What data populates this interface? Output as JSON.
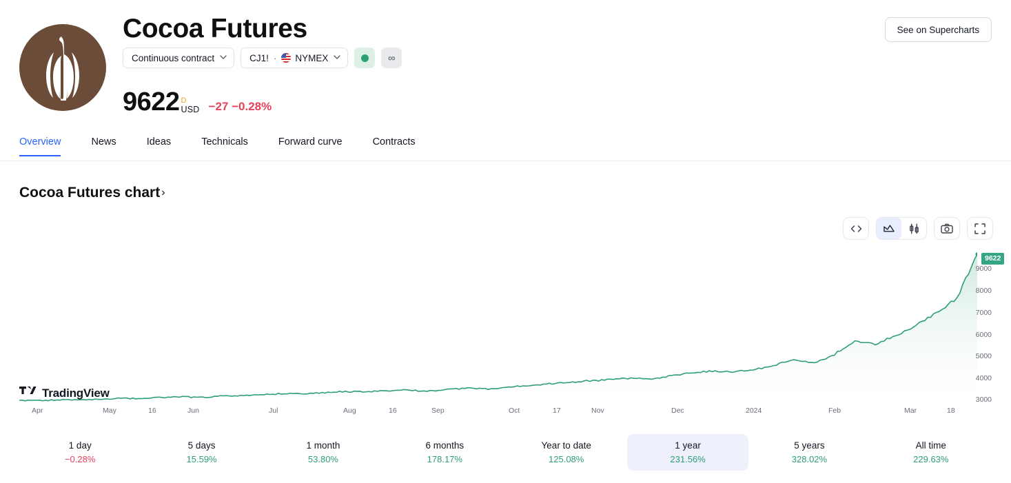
{
  "header": {
    "symbol_logo_name": "cocoa-pod-logo",
    "title": "Cocoa Futures",
    "contract_chip": "Continuous contract",
    "ticker": "CJ1!",
    "separator": "·",
    "exchange": "NYMEX",
    "flag_name": "us-flag-icon",
    "market_status_name": "market-open-dot",
    "continuous_badge": "∞",
    "supercharts_button": "See on Supercharts",
    "price": "9622",
    "price_interval": "D",
    "currency": "USD",
    "change_abs": "−27",
    "change_pct": "−0.28%",
    "change_direction": "down"
  },
  "tabs": [
    {
      "label": "Overview",
      "active": true
    },
    {
      "label": "News",
      "active": false
    },
    {
      "label": "Ideas",
      "active": false
    },
    {
      "label": "Technicals",
      "active": false
    },
    {
      "label": "Forward curve",
      "active": false
    },
    {
      "label": "Contracts",
      "active": false
    }
  ],
  "chart_section": {
    "title": "Cocoa Futures chart",
    "title_arrow": "›",
    "watermark": "TradingView",
    "tools": [
      {
        "name": "embed-code-icon",
        "label": "</>"
      },
      {
        "name": "area-chart-icon",
        "label": "area",
        "selected": true
      },
      {
        "name": "candlestick-chart-icon",
        "label": "candles",
        "selected": false
      },
      {
        "name": "camera-icon",
        "label": "snapshot"
      },
      {
        "name": "fullscreen-icon",
        "label": "fullscreen"
      }
    ]
  },
  "chart_data": {
    "type": "area",
    "title": "Cocoa Futures chart",
    "xlabel": "",
    "ylabel": "",
    "ylim": [
      2700,
      9900
    ],
    "grid": false,
    "legend": "none",
    "line_color": "#2e9e73",
    "fill_top_color": "#d4ece2",
    "fill_bottom_color": "#ffffff",
    "last_value": 9622,
    "last_value_badge": "9622",
    "y_ticks": [
      9000,
      8000,
      7000,
      6000,
      5000,
      4000,
      3000
    ],
    "x_ticks": [
      "Apr",
      "May",
      "16",
      "Jun",
      "Jul",
      "Aug",
      "16",
      "Sep",
      "Oct",
      "17",
      "Nov",
      "Dec",
      "2024",
      "Feb",
      "Mar",
      "18"
    ],
    "x": [
      "Apr",
      "Apr",
      "Apr",
      "Apr",
      "May",
      "May",
      "May",
      "May",
      "Jun",
      "Jun",
      "Jun",
      "Jun",
      "Jul",
      "Jul",
      "Jul",
      "Jul",
      "Aug",
      "Aug",
      "Aug",
      "Aug",
      "Sep",
      "Sep",
      "Sep",
      "Sep",
      "Oct",
      "Oct",
      "Oct",
      "Oct",
      "Nov",
      "Nov",
      "Nov",
      "Nov",
      "Dec",
      "Dec",
      "Dec",
      "Dec",
      "2024",
      "2024",
      "2024",
      "2024",
      "Feb",
      "Feb",
      "Feb",
      "Feb",
      "Mar",
      "Mar",
      "Mar",
      "Mar"
    ],
    "values": [
      2920,
      2905,
      2950,
      2935,
      2975,
      3010,
      3000,
      3055,
      3080,
      3060,
      3120,
      3150,
      3190,
      3230,
      3215,
      3270,
      3330,
      3300,
      3360,
      3390,
      3340,
      3420,
      3470,
      3440,
      3520,
      3600,
      3680,
      3740,
      3810,
      3870,
      3930,
      3890,
      4050,
      4180,
      4260,
      4220,
      4310,
      4520,
      4780,
      4610,
      5030,
      5650,
      5480,
      5900,
      6350,
      6920,
      7600,
      9622
    ]
  },
  "periods": [
    {
      "label": "1 day",
      "value": "−0.28%",
      "direction": "down",
      "selected": false
    },
    {
      "label": "5 days",
      "value": "15.59%",
      "direction": "up",
      "selected": false
    },
    {
      "label": "1 month",
      "value": "53.80%",
      "direction": "up",
      "selected": false
    },
    {
      "label": "6 months",
      "value": "178.17%",
      "direction": "up",
      "selected": false
    },
    {
      "label": "Year to date",
      "value": "125.08%",
      "direction": "up",
      "selected": false
    },
    {
      "label": "1 year",
      "value": "231.56%",
      "direction": "up",
      "selected": true
    },
    {
      "label": "5 years",
      "value": "328.02%",
      "direction": "up",
      "selected": false
    },
    {
      "label": "All time",
      "value": "229.63%",
      "direction": "up",
      "selected": false
    }
  ],
  "colors": {
    "accent_blue": "#2962ff",
    "up_green": "#2e9e73",
    "down_red": "#e8415a",
    "badge_teal": "#35a585",
    "logo_brown": "#6b4c39",
    "interval_orange": "#f0a21c"
  }
}
